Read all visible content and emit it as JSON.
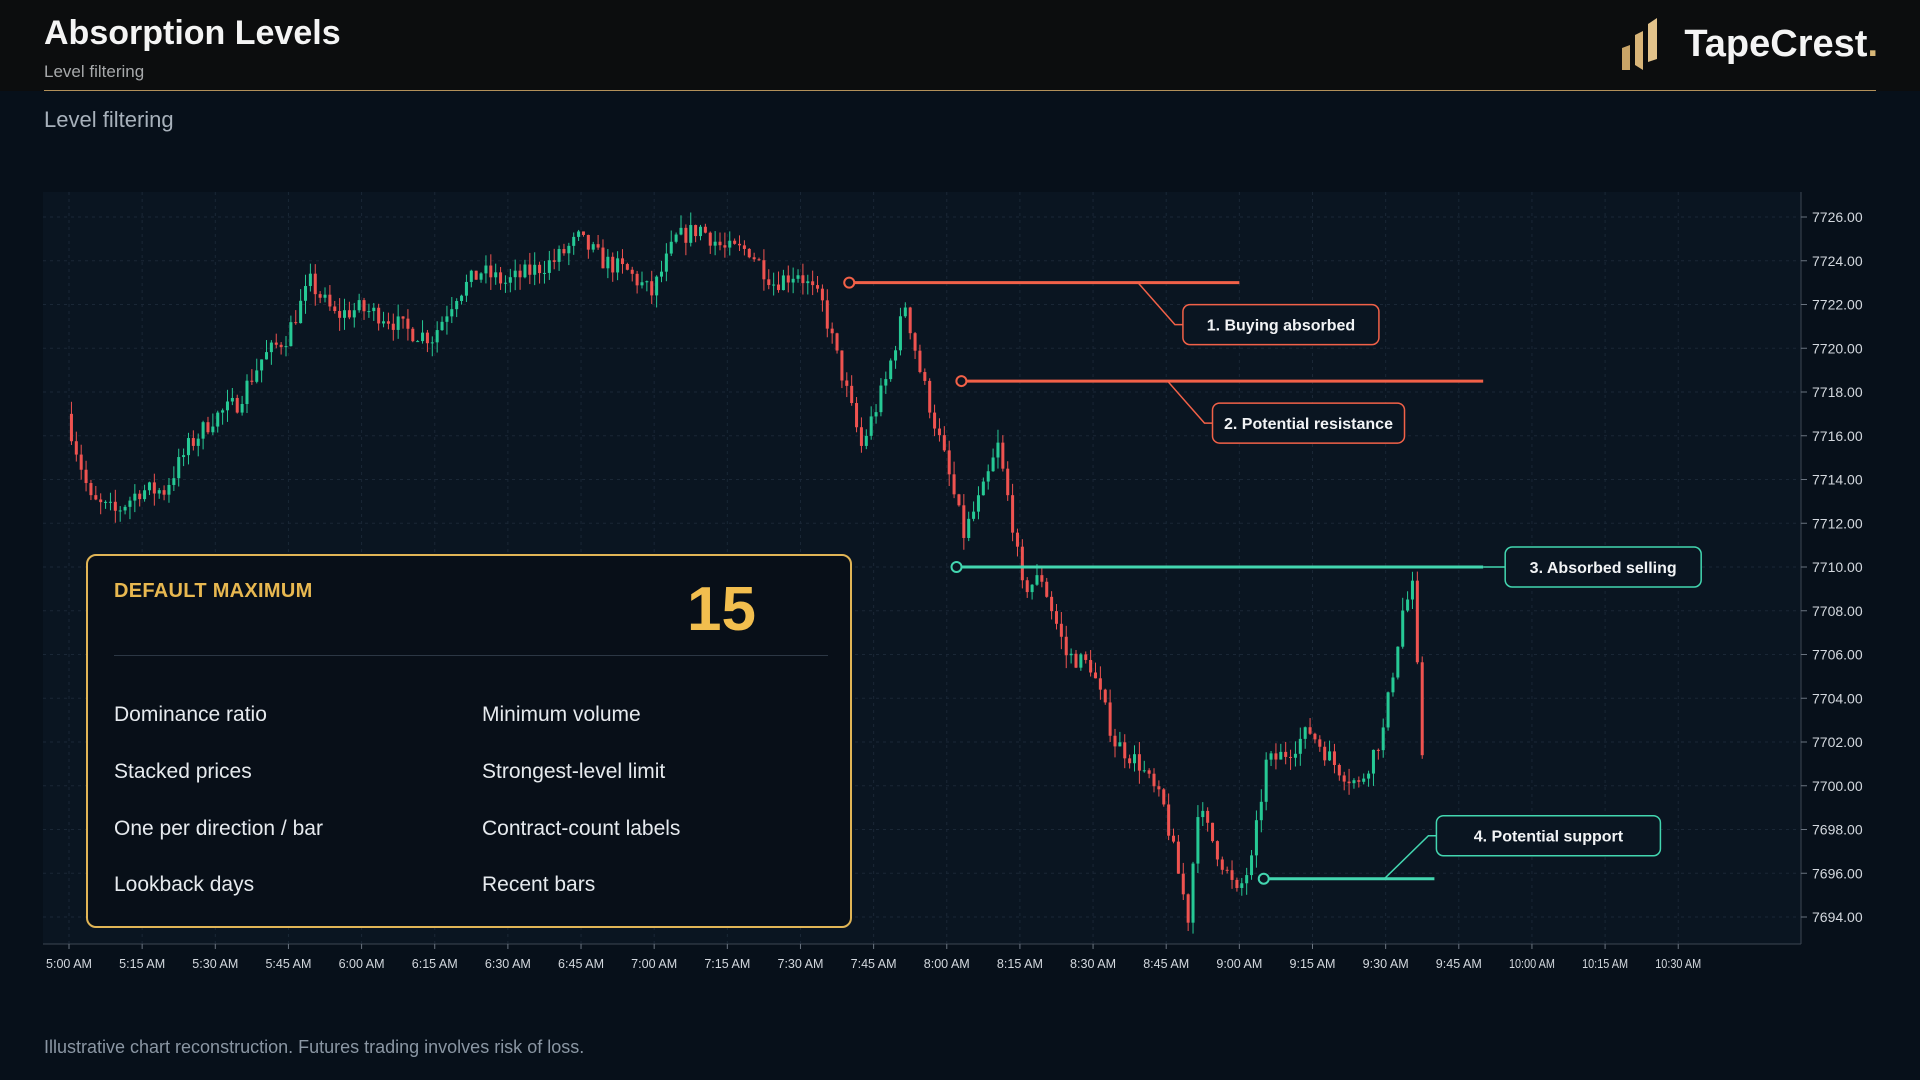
{
  "header": {
    "title": "Absorption Levels",
    "subtitle": "Level filtering",
    "brand": "TapeCrest",
    "brand_dot": "."
  },
  "page_subtitle": "Level filtering",
  "panel": {
    "heading": "DEFAULT MAXIMUM",
    "value": "15",
    "items": [
      "Dominance ratio",
      "Minimum volume",
      "Stacked prices",
      "Strongest-level limit",
      "One per direction / bar",
      "Contract-count labels",
      "Lookback days",
      "Recent bars"
    ]
  },
  "footnote": "Illustrative chart reconstruction. Futures trading involves risk of loss.",
  "colors": {
    "bull": "#26c995",
    "bear": "#ef5350",
    "resistance": "#f26148",
    "support": "#43d6b0",
    "accent": "#e1b556",
    "background": "#07101a"
  },
  "icons": {
    "brand_logo": "bars-logo-icon"
  },
  "chart_data": {
    "type": "candlestick",
    "title": "",
    "xlabel": "",
    "ylabel": "",
    "ylim": [
      7692.5,
      7727
    ],
    "yticks": [
      7694,
      7696,
      7698,
      7700,
      7702,
      7704,
      7706,
      7708,
      7710,
      7712,
      7714,
      7716,
      7718,
      7720,
      7722,
      7724,
      7726
    ],
    "ytick_labels": [
      "7694.00",
      "7696.00",
      "7698.00",
      "7700.00",
      "7702.00",
      "7704.00",
      "7706.00",
      "7708.00",
      "7710.00",
      "7712.00",
      "7714.00",
      "7716.00",
      "7718.00",
      "7720.00",
      "7722.00",
      "7724.00",
      "7726.00"
    ],
    "x_range": [
      "5:00 AM",
      "10:40 AM"
    ],
    "xtick_labels": [
      "5:00 AM",
      "5:15 AM",
      "5:30 AM",
      "5:45 AM",
      "6:00 AM",
      "6:15 AM",
      "6:30 AM",
      "6:45 AM",
      "7:00 AM",
      "7:15 AM",
      "7:30 AM",
      "7:45 AM",
      "8:00 AM",
      "8:15 AM",
      "8:30 AM",
      "8:45 AM",
      "9:00 AM",
      "9:15 AM",
      "9:30 AM",
      "9:45 AM",
      "10:00 AM",
      "10:15 AM",
      "10:30 AM"
    ],
    "grid": true,
    "bar_minutes": 1,
    "close_path": [
      [
        "5:00 AM",
        7717.0
      ],
      [
        "5:05 AM",
        7713.0
      ],
      [
        "5:10 AM",
        7712.5
      ],
      [
        "5:15 AM",
        7713.5
      ],
      [
        "5:20 AM",
        7713.5
      ],
      [
        "5:25 AM",
        7715.5
      ],
      [
        "5:30 AM",
        7716.8
      ],
      [
        "5:35 AM",
        7717.5
      ],
      [
        "5:40 AM",
        7719.5
      ],
      [
        "5:45 AM",
        7720.5
      ],
      [
        "5:50 AM",
        7723.0
      ],
      [
        "5:55 AM",
        7721.5
      ],
      [
        "6:00 AM",
        7721.8
      ],
      [
        "6:05 AM",
        7721.5
      ],
      [
        "6:10 AM",
        7720.8
      ],
      [
        "6:15 AM",
        7720.5
      ],
      [
        "6:20 AM",
        7722.5
      ],
      [
        "6:25 AM",
        7723.5
      ],
      [
        "6:30 AM",
        7723.0
      ],
      [
        "6:35 AM",
        7723.5
      ],
      [
        "6:40 AM",
        7724.0
      ],
      [
        "6:45 AM",
        7725.0
      ],
      [
        "6:50 AM",
        7724.0
      ],
      [
        "6:55 AM",
        7723.5
      ],
      [
        "7:00 AM",
        7722.5
      ],
      [
        "7:05 AM",
        7725.0
      ],
      [
        "7:10 AM",
        7725.5
      ],
      [
        "7:15 AM",
        7724.5
      ],
      [
        "7:20 AM",
        7724.5
      ],
      [
        "7:25 AM",
        7723.0
      ],
      [
        "7:30 AM",
        7723.5
      ],
      [
        "7:35 AM",
        7722.0
      ],
      [
        "7:40 AM",
        7718.0
      ],
      [
        "7:43 AM",
        7715.5
      ],
      [
        "7:48 AM",
        7718.5
      ],
      [
        "7:52 AM",
        7722.0
      ],
      [
        "7:55 AM",
        7719.0
      ],
      [
        "8:00 AM",
        7715.0
      ],
      [
        "8:04 AM",
        7711.5
      ],
      [
        "8:08 AM",
        7713.5
      ],
      [
        "8:11 AM",
        7715.5
      ],
      [
        "8:14 AM",
        7712.0
      ],
      [
        "8:16 AM",
        7709.0
      ],
      [
        "8:20 AM",
        7709.5
      ],
      [
        "8:25 AM",
        7706.0
      ],
      [
        "8:30 AM",
        7705.5
      ],
      [
        "8:35 AM",
        7702.0
      ],
      [
        "8:40 AM",
        7701.0
      ],
      [
        "8:45 AM",
        7699.0
      ],
      [
        "8:50 AM",
        7694.0
      ],
      [
        "8:52 AM",
        7699.0
      ],
      [
        "8:55 AM",
        7697.5
      ],
      [
        "9:00 AM",
        7695.0
      ],
      [
        "9:03 AM",
        7696.5
      ],
      [
        "9:06 AM",
        7701.0
      ],
      [
        "9:10 AM",
        7701.5
      ],
      [
        "9:15 AM",
        7702.5
      ],
      [
        "9:20 AM",
        7701.0
      ],
      [
        "9:25 AM",
        7700.0
      ],
      [
        "9:30 AM",
        7702.5
      ],
      [
        "9:34 AM",
        7708.0
      ],
      [
        "9:36 AM",
        7709.0
      ],
      [
        "9:38 AM",
        7701.5
      ]
    ],
    "levels": [
      {
        "label": "1. Buying absorbed",
        "price": 7723.0,
        "from": "7:40 AM",
        "to": "9:00 AM",
        "type": "resistance",
        "label_pos": "below-right"
      },
      {
        "label": "2. Potential resistance",
        "price": 7718.5,
        "from": "8:03 AM",
        "to": "9:50 AM",
        "type": "resistance",
        "label_pos": "below-right"
      },
      {
        "label": "3. Absorbed selling",
        "price": 7710.0,
        "from": "8:02 AM",
        "to": "9:50 AM",
        "type": "support",
        "label_pos": "right"
      },
      {
        "label": "4. Potential support",
        "price": 7695.75,
        "from": "9:05 AM",
        "to": "9:40 AM",
        "type": "support",
        "label_pos": "above-right"
      }
    ]
  }
}
